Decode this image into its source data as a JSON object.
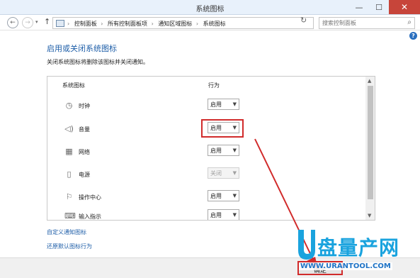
{
  "window": {
    "title": "系统图标",
    "min_glyph": "—",
    "max_glyph": "☐",
    "close_glyph": "✕"
  },
  "address": {
    "back_glyph": "←",
    "forward_glyph": "→",
    "up_glyph": "↑",
    "crumbs": [
      "控制面板",
      "所有控制面板项",
      "通知区域图标",
      "系统图标"
    ],
    "crumb_sep": "›",
    "refresh_glyph": "↻",
    "search_placeholder": "搜索控制面板"
  },
  "help_glyph": "?",
  "main": {
    "heading": "启用或关闭系统图标",
    "description": "关闭系统图标将删除该图标并关闭通知。",
    "col_icon": "系统图标",
    "col_behavior": "行为",
    "rows": [
      {
        "name": "时钟",
        "value": "启用",
        "disabled": false
      },
      {
        "name": "音量",
        "value": "启用",
        "disabled": false
      },
      {
        "name": "网络",
        "value": "启用",
        "disabled": false
      },
      {
        "name": "电源",
        "value": "关闭",
        "disabled": true
      },
      {
        "name": "操作中心",
        "value": "启用",
        "disabled": false
      },
      {
        "name": "输入指示",
        "value": "启用",
        "disabled": false
      }
    ],
    "select_arrow": "▼"
  },
  "links": {
    "customize": "自定义通知图标",
    "restore": "还原默认图标行为"
  },
  "footer": {
    "ok": "确定"
  },
  "watermark": {
    "brand": "盘量产网",
    "url": "WWW.URANTOOL.COM"
  },
  "colors": {
    "accent_link": "#1e5ea8",
    "annotation_red": "#d12b2b",
    "watermark_blue": "#1aa3de"
  }
}
